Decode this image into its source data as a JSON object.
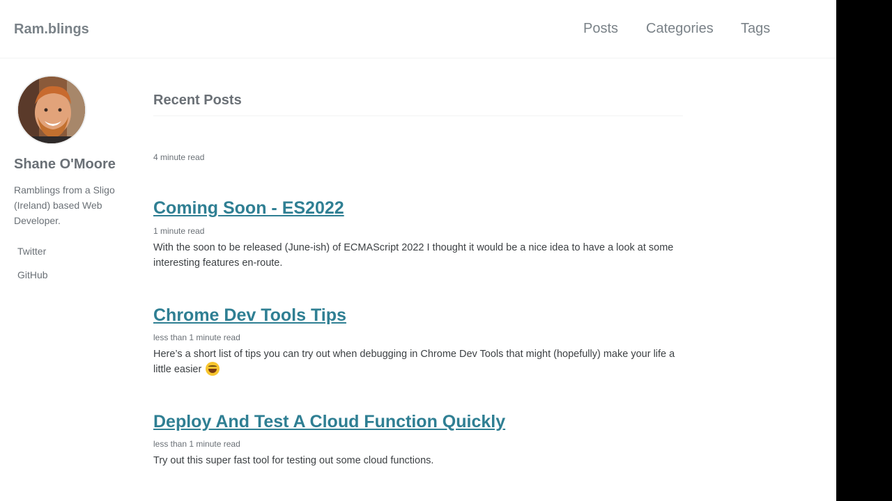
{
  "site": {
    "title": "Ram.blings"
  },
  "nav": {
    "items": [
      {
        "label": "Posts"
      },
      {
        "label": "Categories"
      },
      {
        "label": "Tags"
      }
    ]
  },
  "author": {
    "name": "Shane O'Moore",
    "bio": "Ramblings from a Sligo (Ireland) based Web Developer.",
    "links": [
      {
        "label": "Twitter"
      },
      {
        "label": "GitHub"
      }
    ]
  },
  "main": {
    "section_title": "Recent Posts",
    "first_read_time": "4 minute read",
    "posts": [
      {
        "title": "Coming Soon - ES2022",
        "read_time": "1 minute read",
        "excerpt": "With the soon to be released (June-ish) of ECMAScript 2022 I thought it would be a nice idea to have a look at some interesting features en-route."
      },
      {
        "title": "Chrome Dev Tools Tips",
        "read_time": "less than 1 minute read",
        "excerpt": "Here’s a short list of tips you can try out when debugging in Chrome Dev Tools that might (hopefully) make your life a little easier",
        "emoji": "grinning-face-icon"
      },
      {
        "title": "Deploy And Test A Cloud Function Quickly",
        "read_time": "less than 1 minute read",
        "excerpt": "Try out this super fast tool for testing out some cloud functions."
      }
    ]
  },
  "colors": {
    "link": "#2f7f93",
    "muted": "#7a8288",
    "text": "#3d4144",
    "background": "#ffffff"
  }
}
